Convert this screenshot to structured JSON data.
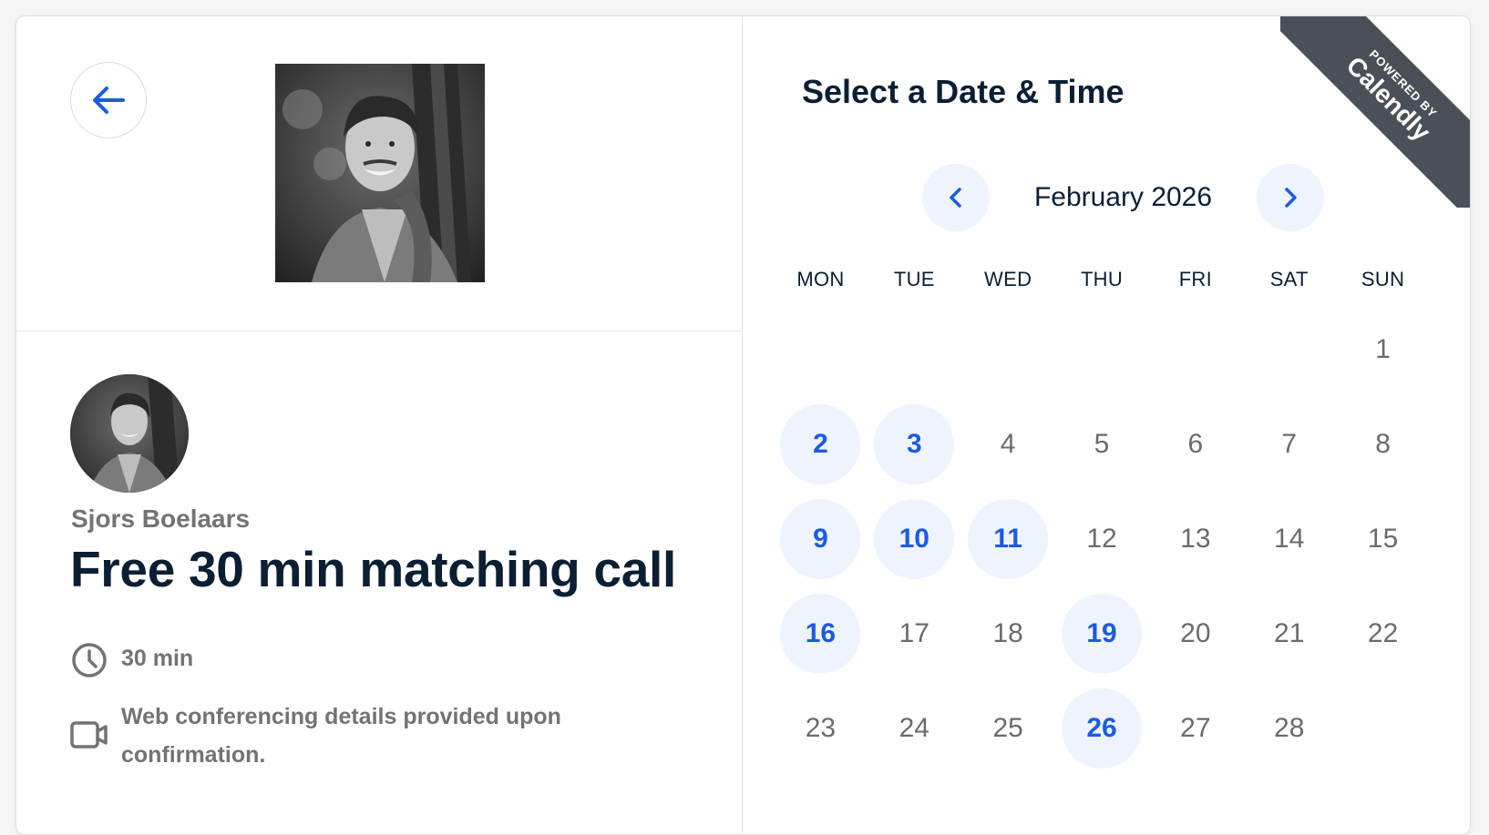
{
  "host": {
    "name": "Sjors Boelaars",
    "photo_alt": "Sjors Boelaars",
    "avatar_alt": "Sjors Boelaars"
  },
  "event": {
    "title": "Free 30 min matching call",
    "duration": "30 min",
    "location": "Web conferencing details provided upon confirmation.",
    "location_line1": "Web conferencing details provided upon",
    "location_line2": "confirmation."
  },
  "scheduler": {
    "title": "Select a Date & Time",
    "month": "February 2026",
    "prev_icon": "chevron-left-icon",
    "next_icon": "chevron-right-icon",
    "weekdays": [
      "MON",
      "TUE",
      "WED",
      "THU",
      "FRI",
      "SAT",
      "SUN"
    ],
    "weeks": [
      [
        null,
        null,
        null,
        null,
        null,
        null,
        {
          "d": "1",
          "a": false
        }
      ],
      [
        {
          "d": "2",
          "a": true
        },
        {
          "d": "3",
          "a": true
        },
        {
          "d": "4",
          "a": false
        },
        {
          "d": "5",
          "a": false
        },
        {
          "d": "6",
          "a": false
        },
        {
          "d": "7",
          "a": false
        },
        {
          "d": "8",
          "a": false
        }
      ],
      [
        {
          "d": "9",
          "a": true
        },
        {
          "d": "10",
          "a": true
        },
        {
          "d": "11",
          "a": true
        },
        {
          "d": "12",
          "a": false
        },
        {
          "d": "13",
          "a": false
        },
        {
          "d": "14",
          "a": false
        },
        {
          "d": "15",
          "a": false
        }
      ],
      [
        {
          "d": "16",
          "a": true
        },
        {
          "d": "17",
          "a": false
        },
        {
          "d": "18",
          "a": false
        },
        {
          "d": "19",
          "a": true
        },
        {
          "d": "20",
          "a": false
        },
        {
          "d": "21",
          "a": false
        },
        {
          "d": "22",
          "a": false
        }
      ],
      [
        {
          "d": "23",
          "a": false
        },
        {
          "d": "24",
          "a": false
        },
        {
          "d": "25",
          "a": false
        },
        {
          "d": "26",
          "a": true
        },
        {
          "d": "27",
          "a": false
        },
        {
          "d": "28",
          "a": false
        },
        null
      ]
    ]
  },
  "badge": {
    "powered_by": "POWERED BY",
    "brand": "Calendly"
  },
  "icons": {
    "back": "arrow-left-icon",
    "duration": "clock-icon",
    "location": "video-camera-icon"
  },
  "colors": {
    "accent": "#1a5ce0",
    "available_bg": "#eef3fe",
    "heading": "#0a1f33",
    "muted": "#737373",
    "ribbon": "#4b5058"
  }
}
